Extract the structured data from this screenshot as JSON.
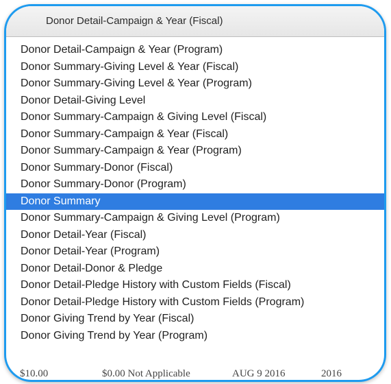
{
  "header": {
    "selected_value": "Donor Detail-Campaign & Year (Fiscal)"
  },
  "menu": {
    "selected_index": 9,
    "items": [
      "Donor Detail-Campaign & Year (Program)",
      "Donor Summary-Giving Level & Year (Fiscal)",
      "Donor Summary-Giving Level & Year (Program)",
      "Donor Detail-Giving Level",
      "Donor Summary-Campaign & Giving Level (Fiscal)",
      "Donor Summary-Campaign & Year (Fiscal)",
      "Donor Summary-Campaign & Year (Program)",
      "Donor Summary-Donor (Fiscal)",
      "Donor Summary-Donor (Program)",
      "Donor Summary",
      "Donor Summary-Campaign & Giving Level (Program)",
      "Donor Detail-Year (Fiscal)",
      "Donor Detail-Year (Program)",
      "Donor Detail-Donor & Pledge",
      "Donor Detail-Pledge History with Custom Fields (Fiscal)",
      "Donor Detail-Pledge History with Custom Fields (Program)",
      "Donor Giving Trend by Year (Fiscal)",
      "Donor Giving Trend by Year (Program)"
    ]
  },
  "background_row": {
    "amount": "$10.00",
    "status": "$0.00 Not Applicable",
    "date": "AUG 9 2016",
    "year": "2016"
  },
  "colors": {
    "frame_border": "#1e9bef",
    "selection": "#2f7de1"
  }
}
